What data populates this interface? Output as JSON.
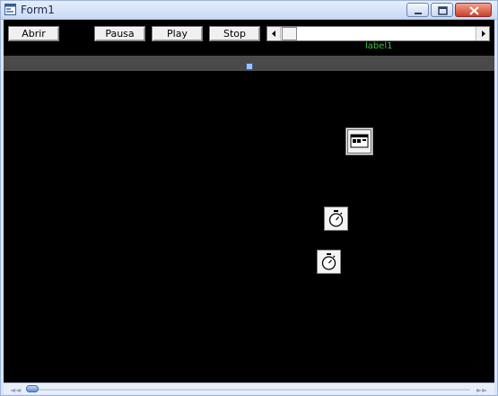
{
  "window": {
    "title": "Form1"
  },
  "toolbar": {
    "open_label": "Abrir",
    "pause_label": "Pausa",
    "play_label": "Play",
    "stop_label": "Stop"
  },
  "scrollbar": {
    "left_arrow": "◀",
    "right_arrow": "▶"
  },
  "label1": {
    "text": "label1"
  },
  "seekbar": {
    "rewind": "◄◄",
    "forward": "►►",
    "position": 0.0
  },
  "icons": {
    "app": "form-icon",
    "minimize": "minimize-icon",
    "maximize": "maximize-icon",
    "close": "close-icon",
    "common_dialog": "common-dialog-icon",
    "timer1": "timer-icon",
    "timer2": "timer-icon"
  },
  "colors": {
    "client_background": "#000000",
    "strip": "#4a4a4a",
    "label_text": "#3dbf3d"
  }
}
